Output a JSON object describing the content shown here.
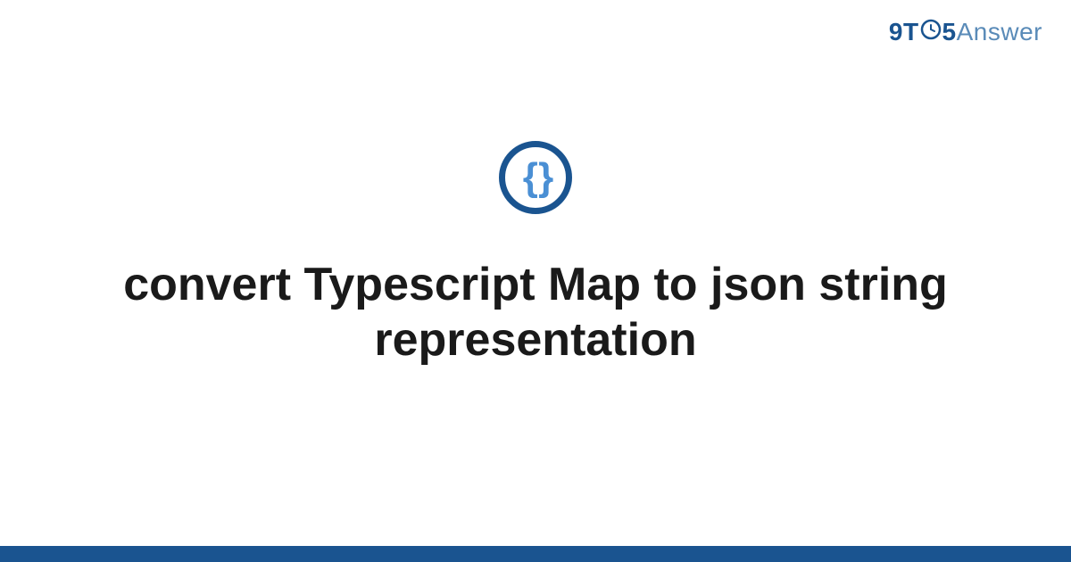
{
  "header": {
    "logo_nine": "9",
    "logo_t": "T",
    "logo_five": "5",
    "logo_answer": "Answer"
  },
  "main": {
    "icon_braces": "{ }",
    "title": "convert Typescript Map to json string representation"
  },
  "colors": {
    "primary": "#1a5490",
    "secondary": "#5a8bb8",
    "accent": "#4a8fd4"
  }
}
